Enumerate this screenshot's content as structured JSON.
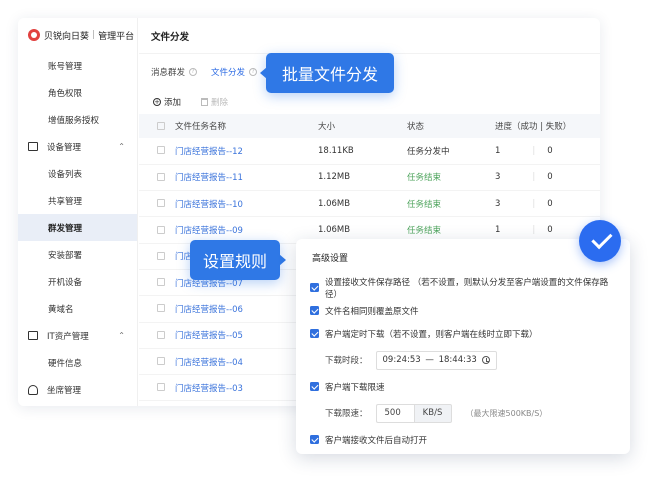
{
  "brand": {
    "name": "贝锐向日葵",
    "sep": "|",
    "suffix": "管理平台"
  },
  "sidebar": {
    "items": [
      {
        "label": "账号管理",
        "type": "item"
      },
      {
        "label": "角色权限",
        "type": "item"
      },
      {
        "label": "增值服务授权",
        "type": "item"
      },
      {
        "label": "设备管理",
        "type": "group"
      },
      {
        "label": "设备列表",
        "type": "item"
      },
      {
        "label": "共享管理",
        "type": "item"
      },
      {
        "label": "群发管理",
        "type": "item",
        "active": true
      },
      {
        "label": "安装部署",
        "type": "item"
      },
      {
        "label": "开机设备",
        "type": "item"
      },
      {
        "label": "黄域名",
        "type": "item"
      },
      {
        "label": "IT资产管理",
        "type": "group"
      },
      {
        "label": "硬件信息",
        "type": "item"
      },
      {
        "label": "坐席管理",
        "type": "group-head"
      }
    ]
  },
  "main": {
    "title": "文件分发",
    "tabs": [
      {
        "label": "消息群发"
      },
      {
        "label": "文件分发",
        "active": true
      }
    ],
    "add_label": "添加",
    "delete_label": "删除",
    "columns": [
      "文件任务名称",
      "大小",
      "状态",
      "进度（成功 | 失败）"
    ],
    "rows": [
      {
        "name": "门店经营报告--12",
        "size": "18.11KB",
        "status": "任务分发中",
        "success": "1",
        "fail": "0"
      },
      {
        "name": "门店经营报告--11",
        "size": "1.12MB",
        "status": "任务结束",
        "success": "3",
        "fail": "0"
      },
      {
        "name": "门店经营报告--10",
        "size": "1.06MB",
        "status": "任务结束",
        "success": "3",
        "fail": "0"
      },
      {
        "name": "门店经营报告--09",
        "size": "1.06MB",
        "status": "任务结束",
        "success": "1",
        "fail": "0"
      },
      {
        "name": "门店经营报告--08",
        "size": "",
        "status": "",
        "success": "",
        "fail": ""
      },
      {
        "name": "门店经营报告--07",
        "size": "",
        "status": "",
        "success": "",
        "fail": ""
      },
      {
        "name": "门店经营报告--06",
        "size": "",
        "status": "",
        "success": "",
        "fail": ""
      },
      {
        "name": "门店经营报告--05",
        "size": "",
        "status": "",
        "success": "",
        "fail": ""
      },
      {
        "name": "门店经营报告--04",
        "size": "",
        "status": "",
        "success": "",
        "fail": ""
      },
      {
        "name": "门店经营报告--03",
        "size": "",
        "status": "",
        "success": "",
        "fail": ""
      }
    ]
  },
  "callouts": {
    "batch": "批量文件分发",
    "rule": "设置规则"
  },
  "panel": {
    "title": "高级设置",
    "opt_path": "设置接收文件保存路径 （若不设置，则默认分发至客户端设置的文件保存路径）",
    "opt_overwrite": "文件名相同则覆盖原文件",
    "opt_schedule": "客户端定时下载（若不设置，则客户端在线时立即下载）",
    "time_label": "下载时段：",
    "time_start": "09:24:53",
    "time_sep": "—",
    "time_end": "18:44:33",
    "opt_limit": "客户端下载限速",
    "speed_label": "下载限速：",
    "speed_value": "500",
    "speed_unit": "KB/S",
    "speed_hint": "（最大限速500KB/S）",
    "opt_autoopen": "客户端接收文件后自动打开"
  },
  "colors": {
    "accent": "#2f78e6",
    "link": "#3a73db",
    "success": "#4ca35b",
    "brand": "#e1413f"
  }
}
